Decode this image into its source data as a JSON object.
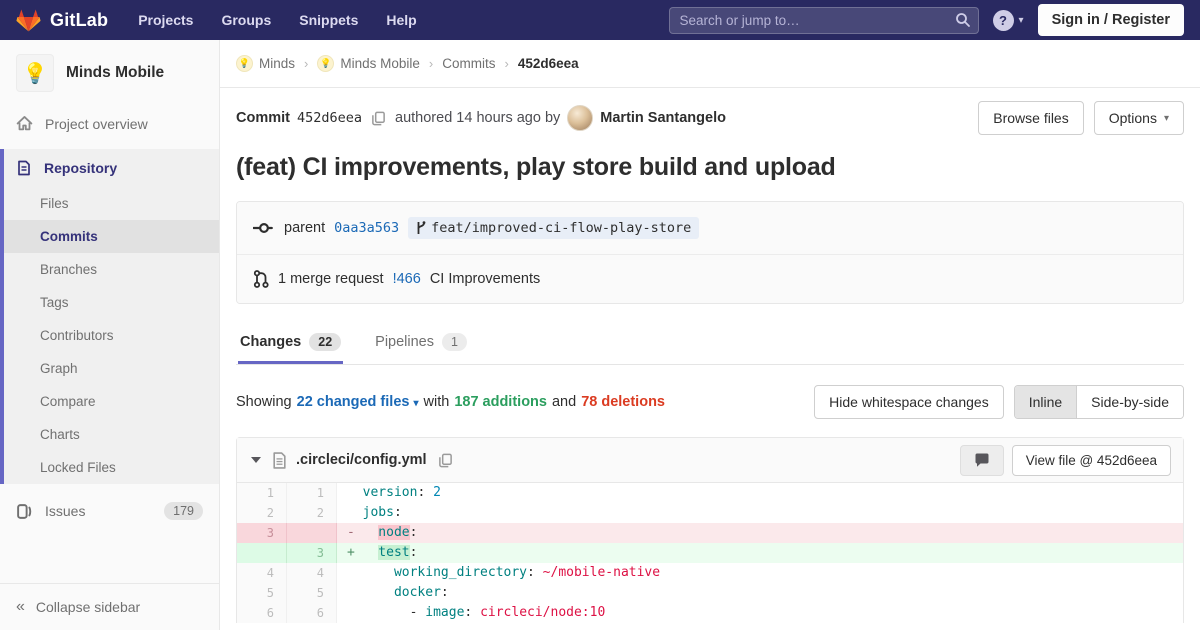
{
  "colors": {
    "navbar_bg": "#292961",
    "accent_indigo": "#6666c4",
    "link_blue": "#1b69b6",
    "additions_green": "#2b9e5e",
    "deletions_red": "#db3b21",
    "removed_line_bg": "#fbe9eb",
    "added_line_bg": "#ecfdf0"
  },
  "navbar": {
    "logo_text": "GitLab",
    "items": [
      "Projects",
      "Groups",
      "Snippets",
      "Help"
    ],
    "search_placeholder": "Search or jump to…",
    "help_glyph": "?",
    "signin_label": "Sign in / Register"
  },
  "sidebar": {
    "project_avatar_emoji": "💡",
    "project_name": "Minds Mobile",
    "overview_label": "Project overview",
    "section_label": "Repository",
    "sub_items": [
      "Files",
      "Commits",
      "Branches",
      "Tags",
      "Contributors",
      "Graph",
      "Compare",
      "Charts",
      "Locked Files"
    ],
    "issues_label": "Issues",
    "issues_count": "179",
    "collapse_label": "Collapse sidebar",
    "collapse_glyph": "«"
  },
  "breadcrumb": {
    "crumb_avatar_emoji": "💡",
    "items": [
      "Minds",
      "Minds Mobile",
      "Commits",
      "452d6eea"
    ],
    "separator": "›"
  },
  "commit": {
    "label": "Commit",
    "sha": "452d6eea",
    "authored_text": "authored 14 hours ago by",
    "author": "Martin Santangelo",
    "browse_label": "Browse files",
    "options_label": "Options",
    "options_caret": "▾",
    "title": "(feat) CI improvements, play store build and upload",
    "parent_label": "parent",
    "parent_sha": "0aa3a563",
    "branch_ref": "feat/improved-ci-flow-play-store",
    "mr_text": "1 merge request",
    "mr_id": "!466",
    "mr_name": "CI Improvements"
  },
  "tabs": {
    "changes_label": "Changes",
    "changes_count": "22",
    "pipelines_label": "Pipelines",
    "pipelines_count": "1"
  },
  "summary": {
    "showing": "Showing",
    "files_link": "22 changed files",
    "files_caret": "▾",
    "with": "with",
    "additions": "187 additions",
    "and": "and",
    "deletions": "78 deletions",
    "hide_whitespace_label": "Hide whitespace changes",
    "inline_label": "Inline",
    "side_by_side_label": "Side-by-side"
  },
  "diff": {
    "filename": ".circleci/config.yml",
    "view_file_label": "View file @ 452d6eea",
    "rows": [
      {
        "old": "1",
        "new": "1",
        "type": "ctx",
        "marker": " ",
        "segs": [
          [
            "version",
            "s-key"
          ],
          [
            ": ",
            "s-p"
          ],
          [
            "2",
            "s-num"
          ]
        ]
      },
      {
        "old": "2",
        "new": "2",
        "type": "ctx",
        "marker": " ",
        "segs": [
          [
            "jobs",
            "s-key"
          ],
          [
            ":",
            "s-p"
          ]
        ]
      },
      {
        "old": "3",
        "new": "",
        "type": "del",
        "marker": "-",
        "segs": [
          [
            "  ",
            "s-p"
          ],
          [
            "node",
            "s-key hl-del"
          ],
          [
            ":",
            "s-p"
          ]
        ]
      },
      {
        "old": "",
        "new": "3",
        "type": "add",
        "marker": "+",
        "segs": [
          [
            "  ",
            "s-p"
          ],
          [
            "test",
            "s-key hl-add"
          ],
          [
            ":",
            "s-p"
          ]
        ]
      },
      {
        "old": "4",
        "new": "4",
        "type": "ctx",
        "marker": " ",
        "segs": [
          [
            "    ",
            "s-p"
          ],
          [
            "working_directory",
            "s-key"
          ],
          [
            ": ",
            "s-p"
          ],
          [
            "~/mobile-native",
            "s-str"
          ]
        ]
      },
      {
        "old": "5",
        "new": "5",
        "type": "ctx",
        "marker": " ",
        "segs": [
          [
            "    ",
            "s-p"
          ],
          [
            "docker",
            "s-key"
          ],
          [
            ":",
            "s-p"
          ]
        ]
      },
      {
        "old": "6",
        "new": "6",
        "type": "ctx",
        "marker": " ",
        "segs": [
          [
            "      - ",
            "s-p"
          ],
          [
            "image",
            "s-key"
          ],
          [
            ": ",
            "s-p"
          ],
          [
            "circleci/node:10",
            "s-str"
          ]
        ]
      }
    ]
  }
}
